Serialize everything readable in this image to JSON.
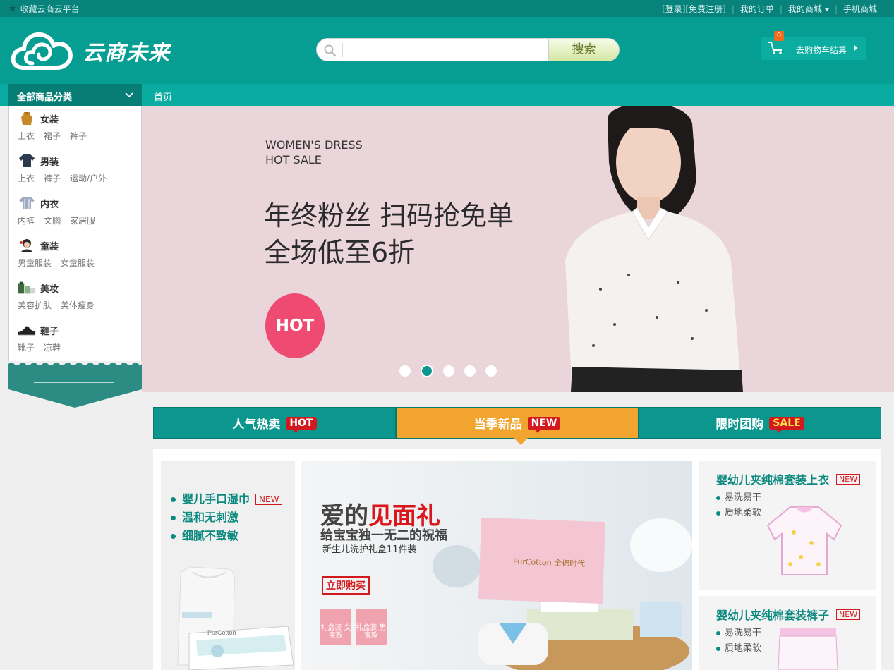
{
  "topbar": {
    "favorite": "收藏云商云平台",
    "login": "[登录][免费注册]",
    "orders": "我的订单",
    "my_mall": "我的商城",
    "mobile": "手机商城"
  },
  "header": {
    "logo_text": "云商未来",
    "search_placeholder": "",
    "search_button": "搜索",
    "cart_count": "0",
    "cart_label": "去购物车结算"
  },
  "nav": {
    "all_categories": "全部商品分类",
    "home": "首页"
  },
  "categories": [
    {
      "title": "女装",
      "icon": "dress-icon",
      "subs": [
        "上衣",
        "裙子",
        "裤子"
      ]
    },
    {
      "title": "男装",
      "icon": "shirt-icon",
      "subs": [
        "上衣",
        "裤子",
        "运动/户外"
      ]
    },
    {
      "title": "内衣",
      "icon": "pajamas-icon",
      "subs": [
        "内裤",
        "文胸",
        "家居服"
      ]
    },
    {
      "title": "童装",
      "icon": "child-icon",
      "subs": [
        "男童服装",
        "女童服装"
      ]
    },
    {
      "title": "美妆",
      "icon": "cosmetics-icon",
      "subs": [
        "美容护肤",
        "美体瘦身"
      ]
    },
    {
      "title": "鞋子",
      "icon": "shoe-icon",
      "subs": [
        "靴子",
        "凉鞋"
      ]
    }
  ],
  "banner": {
    "en_line1": "WOMEN'S DRESS",
    "en_line2": "HOT SALE",
    "cn_line1": "年终粉丝 扫码抢免单",
    "cn_line2": "全场低至6折",
    "badge": "HOT",
    "slide_count": 5,
    "active_slide": 2
  },
  "tabs": [
    {
      "label": "人气热卖",
      "tag": "HOT"
    },
    {
      "label": "当季新品",
      "tag": "NEW"
    },
    {
      "label": "限时团购",
      "tag": "SALE"
    }
  ],
  "products": {
    "wipes": {
      "features": [
        "婴儿手口湿巾",
        "温和无刺激",
        "细腻不致敏"
      ],
      "tag": "NEW",
      "pack_brand": "PurCotton"
    },
    "gift": {
      "title_a": "爱的",
      "title_b": "见面礼",
      "subtitle": "给宝宝独一无二的祝福",
      "desc": "新生儿洗护礼盒11件装",
      "buy": "立即购买",
      "girl_box": "礼盒装 女宝款",
      "boy_box": "礼盒装 男宝款",
      "box_brand": "PurCotton 全棉时代"
    },
    "top": {
      "title": "婴幼儿夹纯棉套装上衣",
      "tag": "NEW",
      "features": [
        "易洗易干",
        "质地柔软"
      ]
    },
    "pants": {
      "title": "婴幼儿夹纯棉套装裤子",
      "tag": "NEW",
      "features": [
        "易洗易干",
        "质地柔软"
      ]
    }
  },
  "colors": {
    "primary": "#069d92",
    "dark": "#07837b",
    "accent": "#f1a42e",
    "hot": "#ee4a72",
    "red": "#d2191d"
  }
}
